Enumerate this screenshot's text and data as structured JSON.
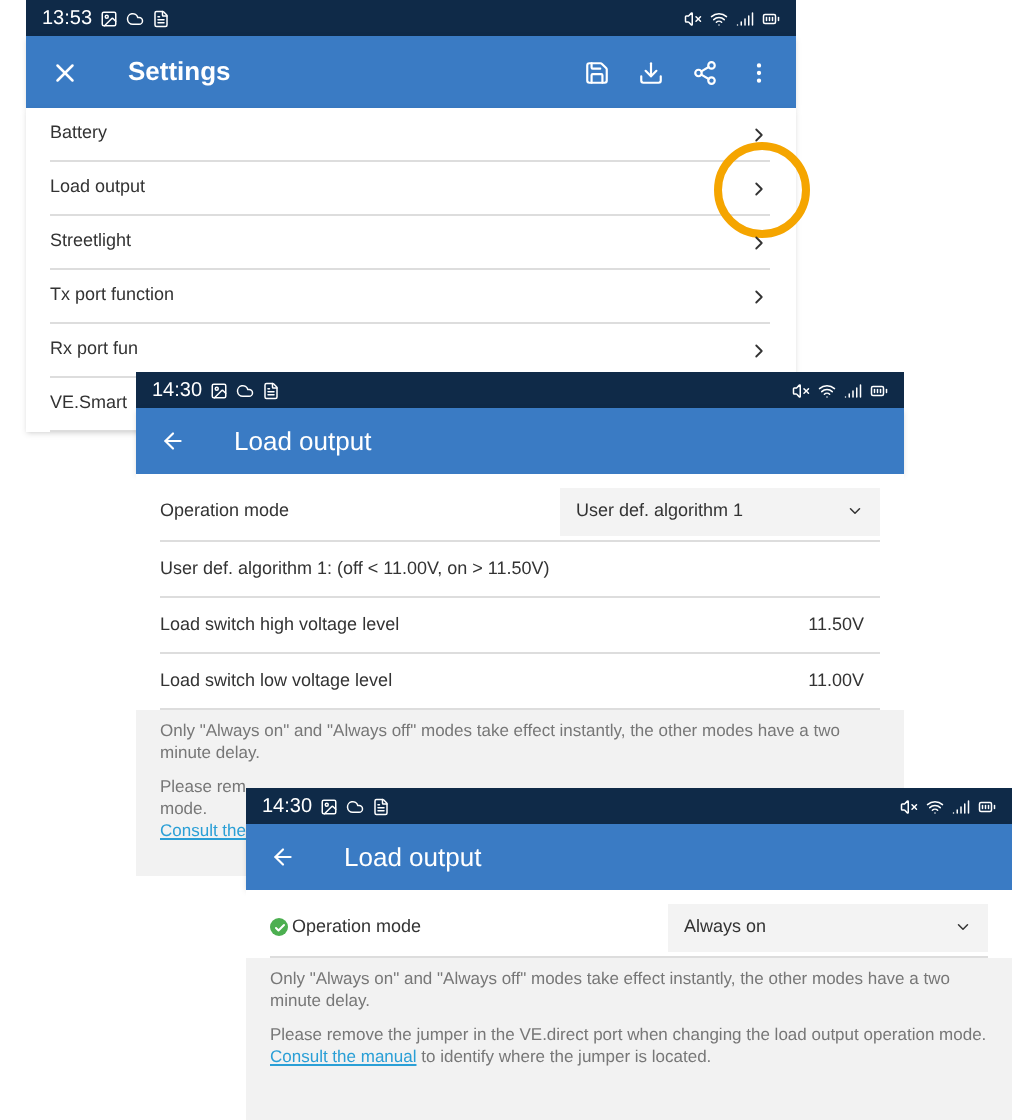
{
  "screens": [
    {
      "kind": "settings",
      "time": "13:53",
      "title": "Settings",
      "items": [
        {
          "label": "Battery",
          "highlighted": false,
          "chevron": true
        },
        {
          "label": "Load output",
          "highlighted": true,
          "chevron": true
        },
        {
          "label": "Streetlight",
          "highlighted": false,
          "chevron": true
        },
        {
          "label": "Tx port function",
          "highlighted": false,
          "chevron": true
        },
        {
          "label": "Rx port fun",
          "highlighted": false,
          "chevron": true
        },
        {
          "label": "VE.Smart",
          "highlighted": false,
          "chevron": false
        }
      ]
    },
    {
      "kind": "detail",
      "time": "14:30",
      "title": "Load output",
      "rows": [
        {
          "kind": "dropdown",
          "label": "Operation mode",
          "value": "User def. algorithm 1",
          "ok": false
        },
        {
          "kind": "text",
          "label": "User def. algorithm 1: (off < 11.00V, on > 11.50V)"
        },
        {
          "kind": "value",
          "label": "Load switch high voltage level",
          "value": "11.50V"
        },
        {
          "kind": "value",
          "label": "Load switch low voltage level",
          "value": "11.00V"
        }
      ],
      "notes": [
        "Only \"Always on\" and \"Always off\" modes take effect instantly, the other modes have a two minute delay.",
        "Please rem",
        "mode."
      ],
      "link": {
        "text": "Consult the"
      }
    },
    {
      "kind": "detail",
      "time": "14:30",
      "title": "Load output",
      "rows": [
        {
          "kind": "dropdown",
          "label": "Operation mode",
          "value": "Always on",
          "ok": true
        }
      ],
      "notes": [
        "Only \"Always on\" and \"Always off\" modes take effect instantly, the other modes have a two minute delay.",
        "Please remove the jumper in the VE.direct port when changing the load output operation mode."
      ],
      "link": {
        "text": "Consult the manual",
        "rest": "to identify where the jumper is located."
      }
    }
  ]
}
